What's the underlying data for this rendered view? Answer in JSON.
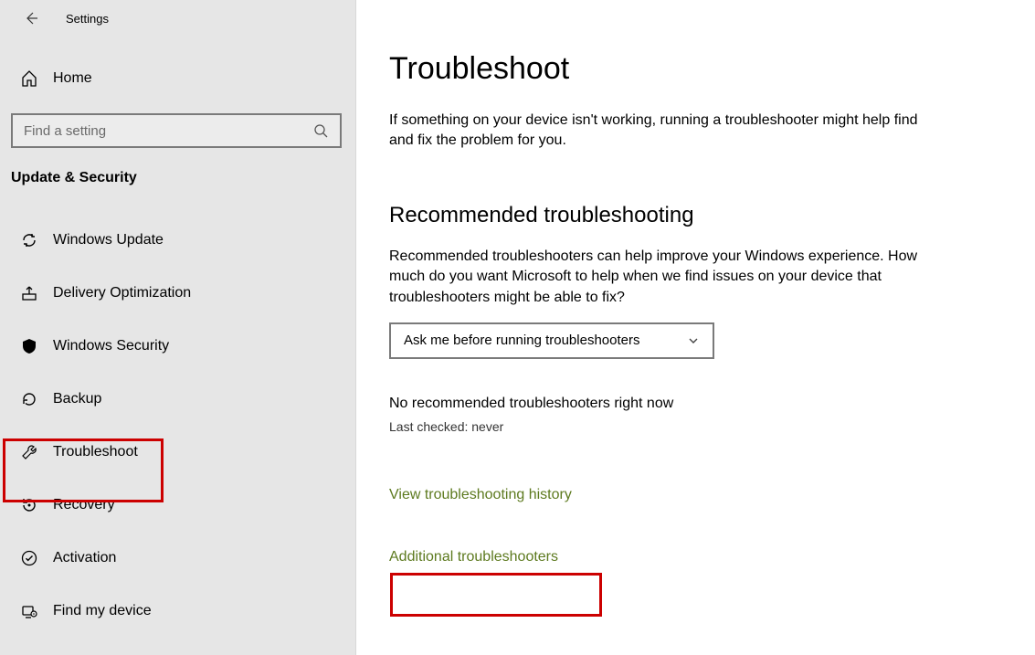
{
  "titlebar": {
    "app_name": "Settings"
  },
  "home": {
    "label": "Home"
  },
  "search": {
    "placeholder": "Find a setting"
  },
  "category": {
    "label": "Update & Security"
  },
  "nav": {
    "items": [
      {
        "label": "Windows Update"
      },
      {
        "label": "Delivery Optimization"
      },
      {
        "label": "Windows Security"
      },
      {
        "label": "Backup"
      },
      {
        "label": "Troubleshoot"
      },
      {
        "label": "Recovery"
      },
      {
        "label": "Activation"
      },
      {
        "label": "Find my device"
      }
    ]
  },
  "main": {
    "title": "Troubleshoot",
    "intro": "If something on your device isn't working, running a troubleshooter might help find and fix the problem for you.",
    "section_title": "Recommended troubleshooting",
    "section_desc": "Recommended troubleshooters can help improve your Windows experience. How much do you want Microsoft to help when we find issues on your device that troubleshooters might be able to fix?",
    "dropdown_value": "Ask me before running troubleshooters",
    "status": "No recommended troubleshooters right now",
    "last_checked": "Last checked: never",
    "link_history": "View troubleshooting history",
    "link_additional": "Additional troubleshooters"
  }
}
